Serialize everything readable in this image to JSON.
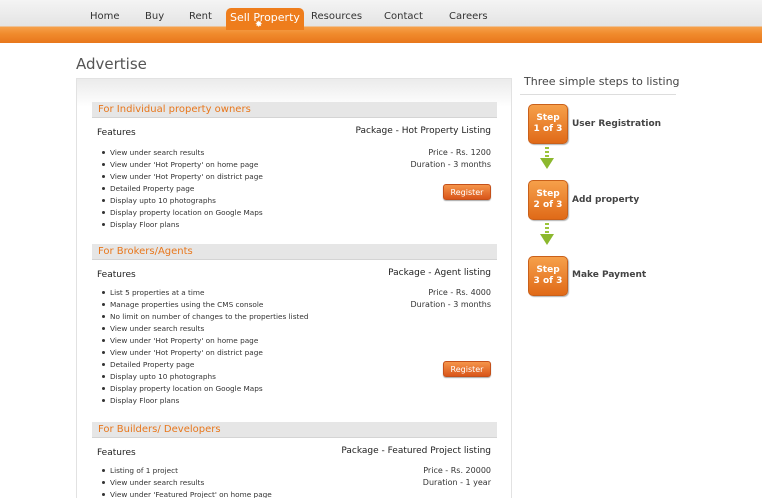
{
  "nav": {
    "items": [
      "Home",
      "Buy",
      "Rent",
      "Sell Property",
      "Resources",
      "Contact",
      "Careers"
    ],
    "active_marker": "✸"
  },
  "page": {
    "title": "Advertise"
  },
  "colors": {
    "accent": "#e8771c",
    "section_bar": "#e6e6e6",
    "button": "#e0601a"
  },
  "sections": [
    {
      "title": "For Individual property owners",
      "features_label": "Features",
      "package": "Package - Hot Property Listing",
      "price": "Price - Rs. 1200",
      "duration": "Duration - 3 months",
      "register_label": "Register",
      "features": [
        "View under search results",
        "View under 'Hot Property' on home page",
        "View under 'Hot Property' on district page",
        "Detailed Property page",
        "Display upto 10 photographs",
        "Display property location on Google Maps",
        "Display Floor plans"
      ]
    },
    {
      "title": "For Brokers/Agents",
      "features_label": "Features",
      "package": "Package - Agent listing",
      "price": "Price - Rs. 4000",
      "duration": "Duration - 3 months",
      "register_label": "Register",
      "features": [
        "List 5 properties at a time",
        "Manage properties using the CMS console",
        "No limit on number of changes to the properties listed",
        "View under search results",
        "View under 'Hot Property' on home page",
        "View under 'Hot Property' on district page",
        "Detailed Property page",
        "Display upto 10 photographs",
        "Display property location on Google Maps",
        "Display Floor plans"
      ]
    },
    {
      "title": "For Builders/ Developers",
      "features_label": "Features",
      "package": "Package - Featured Project listing",
      "price": "Price - Rs. 20000",
      "duration": "Duration - 1 year",
      "features": [
        "Listing of 1 project",
        "View under search results",
        "View under 'Featured Project' on home page"
      ]
    }
  ],
  "sidebar": {
    "title": "Three simple steps to listing",
    "steps": [
      {
        "badge_top": "Step",
        "badge_bottom": "1 of 3",
        "label": "User Registration"
      },
      {
        "badge_top": "Step",
        "badge_bottom": "2 of 3",
        "label": "Add property"
      },
      {
        "badge_top": "Step",
        "badge_bottom": "3 of 3",
        "label": "Make Payment"
      }
    ],
    "arrow_icon": "down-arrow-icon"
  }
}
